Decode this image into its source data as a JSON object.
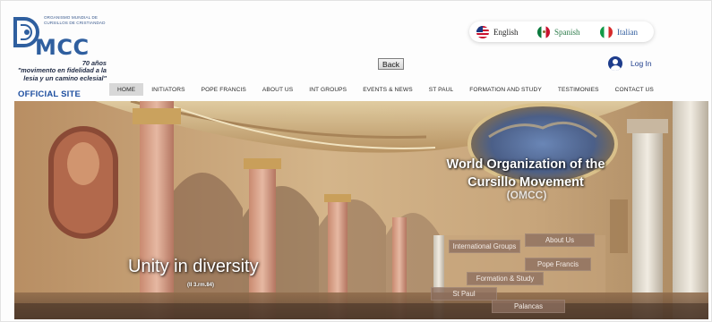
{
  "logo": {
    "small_text": "Organismo Mundial de Cursillos de Cristiandad",
    "wordmark": "MCC",
    "motto_line1": "70 años",
    "motto_line2": "\"movimento en fidelidad a la",
    "motto_line3": "lesia y un camino eclesial\""
  },
  "official_site": "OFFICIAL SITE",
  "languages": [
    {
      "label": "English",
      "icon": "us-flag-icon",
      "color": "#222222"
    },
    {
      "label": "Spanish",
      "icon": "mexico-flag-icon",
      "color": "#2a7a48"
    },
    {
      "label": "Italian",
      "icon": "italy-flag-icon",
      "color": "#2d5a9c"
    }
  ],
  "back_label": "Back",
  "login_label": "Log In",
  "nav": [
    "HOME",
    "INITIATORS",
    "POPE FRANCIS",
    "ABOUT US",
    "INT GROUPS",
    "EVENTS & NEWS",
    "ST PAUL",
    "FORMATION AND STUDY",
    "TESTIMONIES",
    "CONTACT US"
  ],
  "nav_active": "HOME",
  "hero": {
    "title": "World Organization of the Cursillo Movement",
    "subtitle": "(OMCC)",
    "tagline": "Unity in diversity",
    "reference": "(II 3.rm.84)",
    "buttons": {
      "international_groups": "International Groups",
      "about_us": "About Us",
      "pope_francis": "Pope Francis",
      "formation_study": "Formation & Study",
      "st_paul": "St Paul",
      "palancas": "Palancas"
    }
  },
  "colors": {
    "brand_blue": "#2f5f9f",
    "nav_active_bg": "#d8d8d8",
    "hero_button_bg": "#8c6e5f"
  }
}
